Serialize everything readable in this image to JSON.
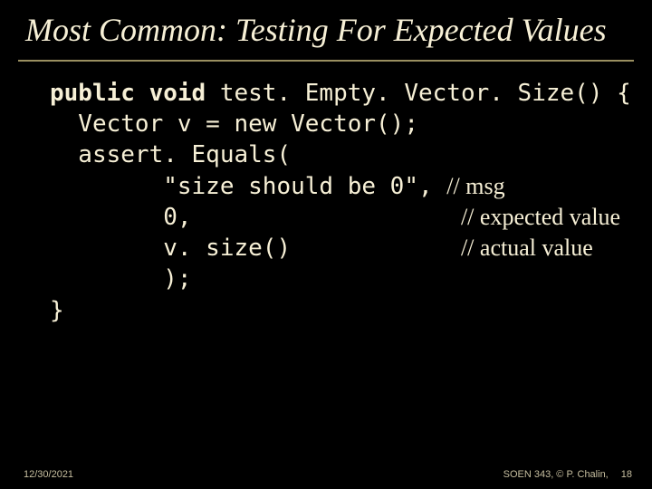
{
  "title": "Most Common: Testing For Expected Values",
  "code": {
    "l1a": "public void",
    "l1b": " test. Empty. Vector. Size() {",
    "l2": "  Vector v = new Vector();",
    "l3": "  assert. Equals(",
    "l4_code": "        \"size should be 0\", ",
    "l4_cmt": "// msg",
    "l5_code": "        0,                   ",
    "l5_cmt": "// expected value",
    "l6_code": "        v. size()            ",
    "l6_cmt": "// actual value",
    "l7": "        );",
    "l8": "}"
  },
  "footer": {
    "date": "12/30/2021",
    "course": "SOEN 343, © P. Chalin,",
    "page": "18"
  }
}
